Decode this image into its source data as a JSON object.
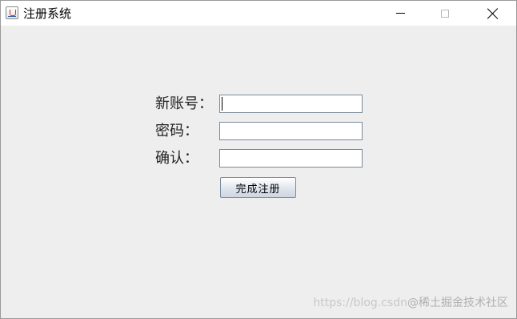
{
  "window": {
    "title": "注册系统",
    "controls": {
      "minimize": "minimize-icon",
      "maximize": "maximize-icon",
      "close": "close-icon"
    }
  },
  "form": {
    "account_label": "新账号：",
    "password_label": "密码：",
    "confirm_label": "确认：",
    "account_value": "",
    "password_value": "",
    "confirm_value": "",
    "submit_label": "完成注册"
  },
  "watermark": {
    "url": "https://blog.csdn",
    "brand": "@稀土掘金技术社区"
  }
}
